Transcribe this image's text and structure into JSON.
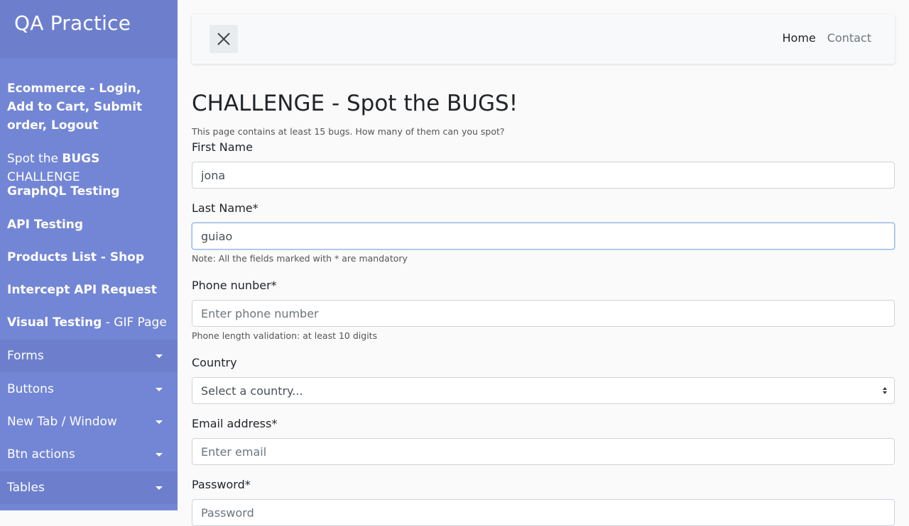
{
  "sidebar": {
    "brand": "QA Practice",
    "links": [
      {
        "bold": "Ecommerce - Login, Add to Cart, Submit order, Logout",
        "rest": ""
      },
      {
        "pre": "Spot the ",
        "bold": "BUGS",
        "rest": " CHALLENGE"
      },
      {
        "bold": "GraphQL Testing",
        "rest": ""
      },
      {
        "bold": "API Testing",
        "rest": ""
      },
      {
        "bold": "Products List - Shop",
        "rest": ""
      },
      {
        "bold": "Intercept API Request",
        "rest": ""
      },
      {
        "bold": "Visual Testing",
        "rest": " - GIF Page"
      }
    ],
    "dropdowns": [
      "Forms",
      "Buttons",
      "New Tab / Window",
      "Btn actions",
      "Tables"
    ]
  },
  "topbar": {
    "home": "Home",
    "contact": "Contact",
    "toggle_icon": "close-icon"
  },
  "main": {
    "title": "CHALLENGE - Spot the BUGS!",
    "intro": "This page contains at least 15 bugs. How many of them can you spot?",
    "first_name": {
      "label": "First Name",
      "value": "jona"
    },
    "last_name": {
      "label": "Last Name*",
      "value": "guiao"
    },
    "mandatory_note": "Note: All the fields marked with * are mandatory",
    "phone": {
      "label": "Phone nunber*",
      "placeholder": "Enter phone number"
    },
    "phone_note": "Phone length validation: at least 10 digits",
    "country": {
      "label": "Country",
      "selected": "Select a country..."
    },
    "email": {
      "label": "Email address*",
      "placeholder": "Enter email"
    },
    "password": {
      "label": "Password*",
      "placeholder": "Password"
    }
  },
  "colors": {
    "sidebar_bg": "#7386d5",
    "sidebar_active": "#6d7fcc",
    "page_bg": "#fafafa"
  }
}
